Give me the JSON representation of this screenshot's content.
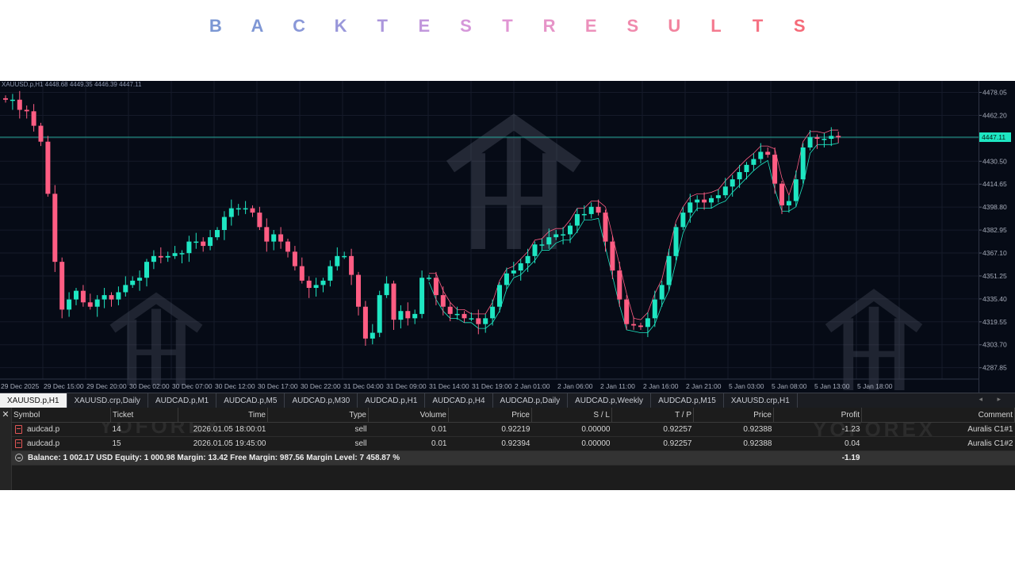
{
  "title": {
    "letters": [
      "B",
      "A",
      "C",
      "K",
      "T",
      "E",
      "S",
      "T",
      "R",
      "E",
      "S",
      "U",
      "L",
      "T",
      "S"
    ],
    "colors": [
      "#7b97d3",
      "#7f97d5",
      "#8a98d8",
      "#9997da",
      "#ab96dc",
      "#c197dc",
      "#d597d9",
      "#e095d3",
      "#e694c8",
      "#ec90bb",
      "#f08aad",
      "#f2839e",
      "#f47a8f",
      "#f57283",
      "#f56a78"
    ]
  },
  "chart": {
    "symbol_info": "XAUUSD.p,H1  4448.68 4449.35 4446.39 4447.11",
    "current_price": "4447.11",
    "price_labels": [
      "4478.05",
      "4462.20",
      "4446.35",
      "4430.50",
      "4414.65",
      "4398.80",
      "4382.95",
      "4367.10",
      "4351.25",
      "4335.40",
      "4319.55",
      "4303.70",
      "4287.85"
    ],
    "time_labels": [
      "29 Dec 2025",
      "29 Dec 15:00",
      "29 Dec 20:00",
      "30 Dec 02:00",
      "30 Dec 07:00",
      "30 Dec 12:00",
      "30 Dec 17:00",
      "30 Dec 22:00",
      "31 Dec 04:00",
      "31 Dec 09:00",
      "31 Dec 14:00",
      "31 Dec 19:00",
      "2 Jan 01:00",
      "2 Jan 06:00",
      "2 Jan 11:00",
      "2 Jan 16:00",
      "2 Jan 21:00",
      "5 Jan 03:00",
      "5 Jan 08:00",
      "5 Jan 13:00",
      "5 Jan 18:00"
    ],
    "colors": {
      "bull": "#1ee6c2",
      "bear": "#ff5d83",
      "background": "#060b16",
      "grid": "#151b29",
      "price_line": "#27a89a",
      "envelope_upper": "#ff5d83",
      "envelope_lower": "#1ee6c2"
    },
    "watermark": "YOFOREX"
  },
  "chart_data": {
    "type": "candlestick",
    "closes": [
      4473,
      4473,
      4466,
      4465,
      4455,
      4444,
      4408,
      4361,
      4328,
      4335,
      4341,
      4333,
      4330,
      4335,
      4338,
      4335,
      4340,
      4345,
      4348,
      4350,
      4361,
      4365,
      4364,
      4365,
      4367,
      4367,
      4375,
      4375,
      4372,
      4378,
      4383,
      4392,
      4398,
      4398,
      4398,
      4395,
      4385,
      4375,
      4380,
      4375,
      4368,
      4358,
      4348,
      4343,
      4345,
      4348,
      4358,
      4365,
      4365,
      4352,
      4330,
      4308,
      4312,
      4338,
      4346,
      4321,
      4327,
      4322,
      4325,
      4350,
      4350,
      4338,
      4330,
      4325,
      4325,
      4322,
      4322,
      4318,
      4322,
      4330,
      4345,
      4353,
      4355,
      4360,
      4365,
      4373,
      4373,
      4378,
      4380,
      4380,
      4386,
      4394,
      4394,
      4399,
      4395,
      4375,
      4355,
      4335,
      4318,
      4317,
      4316,
      4322,
      4335,
      4345,
      4365,
      4385,
      4395,
      4402,
      4404,
      4402,
      4405,
      4407,
      4413,
      4418,
      4423,
      4428,
      4432,
      4437,
      4435,
      4415,
      4400,
      4403,
      4418,
      4440,
      4447,
      4446,
      4446,
      4448,
      4447
    ],
    "ylim": [
      4280,
      4486
    ],
    "symbol": "XAUUSD.p",
    "timeframe": "H1"
  },
  "tabs": [
    "XAUUSD.p,H1",
    "XAUUSD.crp,Daily",
    "AUDCAD.p,M1",
    "AUDCAD.p,M5",
    "AUDCAD.p,M30",
    "AUDCAD.p,H1",
    "AUDCAD.p,H4",
    "AUDCAD.p,Daily",
    "AUDCAD.p,Weekly",
    "AUDCAD.p,M15",
    "XAUUSD.crp,H1"
  ],
  "terminal": {
    "columns": [
      "Symbol",
      "Ticket",
      "Time",
      "Type",
      "Volume",
      "Price",
      "S / L",
      "T / P",
      "Price",
      "Profit",
      "Comment"
    ],
    "rows": [
      {
        "symbol": "audcad.p",
        "ticket": "14",
        "time": "2026.01.05 18:00:01",
        "type": "sell",
        "volume": "0.01",
        "price": "0.92219",
        "sl": "0.00000",
        "tp": "0.92257",
        "current": "0.92388",
        "profit": "-1.23",
        "comment": "Auralis C1#1"
      },
      {
        "symbol": "audcad.p",
        "ticket": "15",
        "time": "2026.01.05 19:45:00",
        "type": "sell",
        "volume": "0.01",
        "price": "0.92394",
        "sl": "0.00000",
        "tp": "0.92257",
        "current": "0.92388",
        "profit": "0.04",
        "comment": "Auralis C1#2"
      }
    ],
    "summary": "Balance: 1 002.17 USD  Equity: 1 000.98  Margin: 13.42  Free Margin: 987.56  Margin Level: 7 458.87 %",
    "summary_profit": "-1.19",
    "close_glyph": "✕"
  }
}
